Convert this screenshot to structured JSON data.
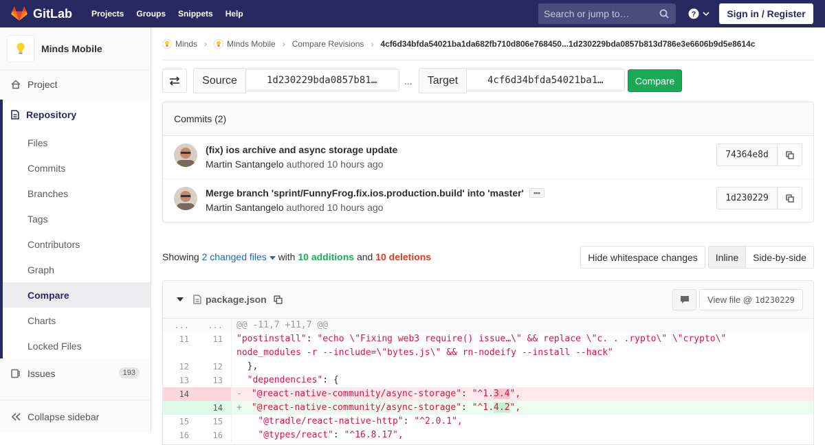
{
  "navbar": {
    "brand": "GitLab",
    "links": [
      "Projects",
      "Groups",
      "Snippets",
      "Help"
    ],
    "search_placeholder": "Search or jump to…",
    "signin": "Sign in / Register",
    "colors": {
      "bg": "#292961",
      "logo_orange": "#fc6d26"
    }
  },
  "sidebar": {
    "project_name": "Minds Mobile",
    "project": "Project",
    "repository": "Repository",
    "repo_items": [
      "Files",
      "Commits",
      "Branches",
      "Tags",
      "Contributors",
      "Graph",
      "Compare",
      "Charts",
      "Locked Files"
    ],
    "active_item": "Compare",
    "issues": "Issues",
    "issues_count": "193",
    "collapse": "Collapse sidebar"
  },
  "breadcrumb": {
    "items": [
      "Minds",
      "Minds Mobile",
      "Compare Revisions"
    ],
    "current": "4cf6d34bfda54021ba1da682fb710d806e768450...1d230229bda0857b813d786e3e6606b9d5e8614c"
  },
  "compare": {
    "source_label": "Source",
    "source_value": "1d230229bda0857b81…",
    "dots": "...",
    "target_label": "Target",
    "target_value": "4cf6d34bfda54021ba1…",
    "button": "Compare",
    "button_color": "#1aaa55"
  },
  "commits": {
    "header": "Commits (2)",
    "items": [
      {
        "title": "(fix) ios archive and async storage update",
        "author": "Martin Santangelo",
        "action": "authored",
        "time": "10 hours ago",
        "sha": "74364e8d"
      },
      {
        "title": "Merge branch 'sprint/FunnyFrog.fix.ios.production.build' into 'master'",
        "author": "Martin Santangelo",
        "action": "authored",
        "time": "10 hours ago",
        "sha": "1d230229"
      }
    ]
  },
  "summary": {
    "showing": "Showing",
    "changed": "2 changed files",
    "with": "with",
    "additions": "10 additions",
    "and": "and",
    "deletions": "10 deletions",
    "hide_ws": "Hide whitespace changes",
    "inline": "Inline",
    "side_by_side": "Side-by-side"
  },
  "file": {
    "name": "package.json",
    "view_label": "View file @",
    "view_sha": "1d230229",
    "hunk_header": "@@ -11,7 +11,7 @@",
    "lines": [
      {
        "old": "11",
        "new": "11",
        "type": "ctx",
        "key": "\"postinstall\"",
        "sep": ": ",
        "val": "\"echo \\\"Fixing web3 require() issue…\\\" && replace \\\"c. . .rypto\\\" \\\"crypto\\\" node_modules -r --include=\\\"bytes.js\\\" && rn-nodeify --install --hack\""
      },
      {
        "old": "12",
        "new": "12",
        "type": "ctx",
        "text": "  },"
      },
      {
        "old": "13",
        "new": "13",
        "type": "ctx",
        "key": "\"dependencies\"",
        "sep": ": {",
        "val": ""
      },
      {
        "old": "14",
        "new": "",
        "type": "del",
        "key": "\"@react-native-community/async-storage\"",
        "sep": ": ",
        "pre": "\"^1.",
        "hl": "3.4",
        "post": "\","
      },
      {
        "old": "",
        "new": "14",
        "type": "add",
        "key": "\"@react-native-community/async-storage\"",
        "sep": ": ",
        "pre": "\"^1.",
        "hl": "4.2",
        "post": "\","
      },
      {
        "old": "15",
        "new": "15",
        "type": "ctx",
        "key": "\"@tradle/react-native-http\"",
        "sep": ": ",
        "val": "\"^2.0.1\","
      },
      {
        "old": "16",
        "new": "16",
        "type": "ctx",
        "key": "\"@types/react\"",
        "sep": ": ",
        "val": "\"^16.8.17\","
      }
    ]
  }
}
